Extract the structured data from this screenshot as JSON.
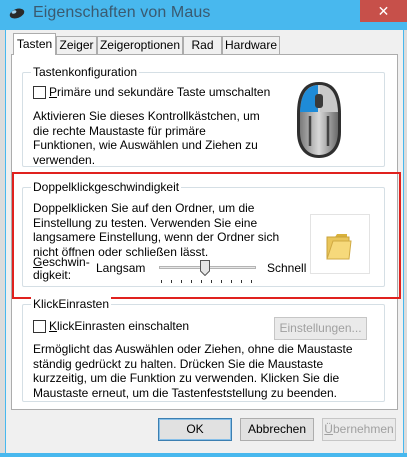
{
  "window": {
    "title": "Eigenschaften von Maus",
    "close_glyph": "✕",
    "app_icon": "mouse-icon"
  },
  "tabs": [
    "Tasten",
    "Zeiger",
    "Zeigeroptionen",
    "Rad",
    "Hardware"
  ],
  "active_tab": "Tasten",
  "button_config": {
    "title": "Tastenkonfiguration",
    "checkbox_label": "Primäre und sekundäre Taste umschalten",
    "checkbox_checked": false,
    "description": "Aktivieren Sie dieses Kontrollkästchen, um die rechte Maustaste für primäre Funktionen, wie Auswählen und Ziehen zu verwenden.",
    "image": "mouse-illustration"
  },
  "double_click": {
    "title": "Doppelklickgeschwindigkeit",
    "description": "Doppelklicken Sie auf den Ordner, um die Einstellung zu testen. Verwenden Sie eine langsamere Einstellung, wenn der Ordner sich nicht öffnen oder schließen lässt.",
    "speed_label_line1": "Geschwin-",
    "speed_label_line2": "digkeit:",
    "slow_label": "Langsam",
    "fast_label": "Schnell",
    "slider_value": 0.45,
    "test_icon": "folder-icon"
  },
  "click_lock": {
    "title": "KlickEinrasten",
    "checkbox_label": "KlickEinrasten einschalten",
    "checkbox_checked": false,
    "settings_button": "Einstellungen...",
    "description": "Ermöglicht das Auswählen oder Ziehen, ohne die Maustaste ständig gedrückt zu halten. Drücken Sie die Maustaste kurzzeitig, um die Funktion zu verwenden. Klicken Sie die Maustaste erneut, um die Tastenfeststellung zu beenden."
  },
  "footer": {
    "ok": "OK",
    "cancel": "Abbrechen",
    "apply": "Übernehmen"
  },
  "colors": {
    "titlebar": "#48b8ee",
    "close_button": "#c7504a",
    "highlight_box": "#e0211e"
  }
}
